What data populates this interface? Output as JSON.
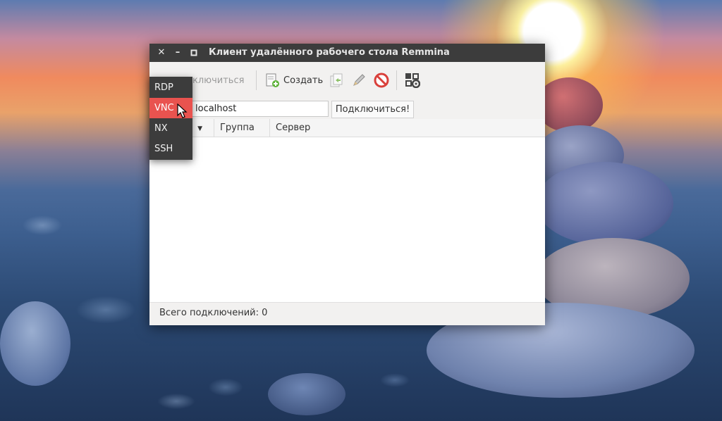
{
  "window": {
    "title": "Клиент удалённого рабочего стола Remmina",
    "close_glyph": "✕",
    "minimize_glyph": "–",
    "maximize_glyph": "▫"
  },
  "toolbar": {
    "connect_label": "дключиться",
    "create_label": "Создать",
    "icons": [
      "connect-icon",
      "new-connection-icon",
      "copy-icon",
      "edit-pencil-icon",
      "delete-icon",
      "preferences-icon"
    ]
  },
  "quickconnect": {
    "server_value": "localhost",
    "connect_button": "Подключиться!"
  },
  "table": {
    "columns": [
      "e",
      "Группа",
      "Сервер"
    ]
  },
  "status": {
    "text": "Всего подключений: 0"
  },
  "protocol_menu": {
    "items": [
      "RDP",
      "VNC",
      "NX",
      "SSH"
    ],
    "selected": "VNC"
  },
  "colors": {
    "titlebar": "#3c3c3c",
    "menu_highlight": "#e9534f",
    "toolbar_bg": "#f2f1f0"
  }
}
